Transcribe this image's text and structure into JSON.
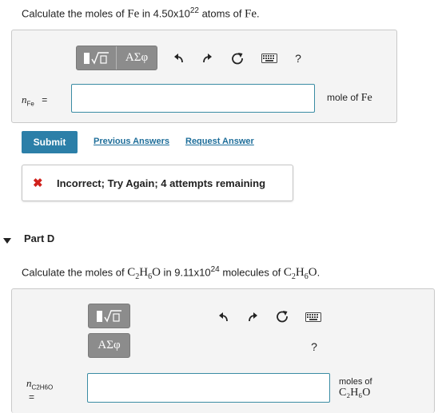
{
  "part_c": {
    "question_prefix": "Calculate the moles of ",
    "question_element": "Fe",
    "question_mid": " in 4.50x10",
    "question_exp": "22",
    "question_suffix": " atoms of ",
    "question_element2": "Fe",
    "question_end": ".",
    "toolbar": {
      "template_glyph": "√",
      "greek_label": "ΑΣφ",
      "help_label": "?"
    },
    "answer_var": "n",
    "answer_var_sub": "Fe",
    "equals": "=",
    "answer_value": "",
    "unit_prefix": "mole of ",
    "unit_element": "Fe",
    "submit_label": "Submit",
    "previous_answers_label": "Previous Answers",
    "request_answer_label": "Request Answer",
    "feedback_icon": "✖",
    "feedback_text": "Incorrect; Try Again; 4 attempts remaining"
  },
  "part_d": {
    "title": "Part D",
    "question_prefix": "Calculate the moles of ",
    "formula_c": "C",
    "formula_c_sub": "2",
    "formula_h": "H",
    "formula_h_sub": "6",
    "formula_o": "O",
    "question_mid": " in 9.11x10",
    "question_exp": "24",
    "question_suffix": " molecules of ",
    "question_end": ".",
    "toolbar": {
      "template_glyph": "√",
      "greek_label": "ΑΣφ",
      "help_label": "?"
    },
    "answer_var": "n",
    "answer_var_sub": "C2H6O",
    "equals": "=",
    "answer_value": "",
    "unit_line1": "moles of",
    "unit_formula": "C₂H₆O"
  },
  "colors": {
    "accent": "#2c7fa8",
    "link": "#1e6e9a",
    "error": "#d0211c",
    "input_border": "#3a8ca3",
    "toolbar_gray": "#8c8c8c"
  }
}
